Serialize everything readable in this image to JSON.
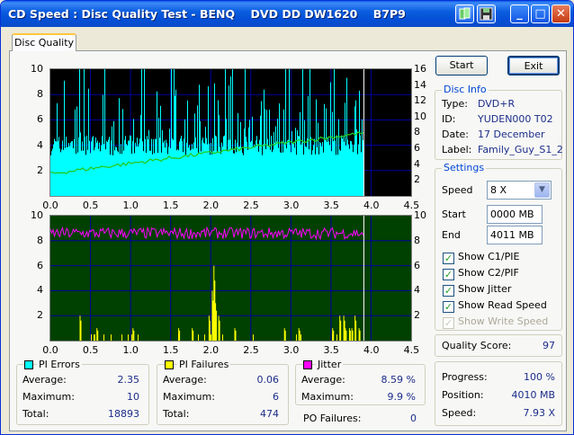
{
  "window": {
    "title": "CD Speed : Disc Quality Test - BENQ    DVD DD DW1620    B7P9",
    "tab": "Disc Quality"
  },
  "buttons": {
    "start": "Start",
    "exit": "Exit"
  },
  "disc_info": {
    "title": "Disc Info",
    "rows": [
      {
        "label": "Type:",
        "value": "DVD+R"
      },
      {
        "label": "ID:",
        "value": "YUDEN000 T02"
      },
      {
        "label": "Date:",
        "value": "17 December"
      },
      {
        "label": "Label:",
        "value": "Family_Guy_S1_2"
      }
    ]
  },
  "settings": {
    "title": "Settings",
    "speed_label": "Speed",
    "speed_value": "8 X",
    "start_label": "Start",
    "start_value": "0000 MB",
    "end_label": "End",
    "end_value": "4011 MB",
    "checks": [
      {
        "label": "Show C1/PIE",
        "checked": true,
        "disabled": false
      },
      {
        "label": "Show C2/PIF",
        "checked": true,
        "disabled": false
      },
      {
        "label": "Show Jitter",
        "checked": true,
        "disabled": false
      },
      {
        "label": "Show Read Speed",
        "checked": true,
        "disabled": false
      },
      {
        "label": "Show Write Speed",
        "checked": true,
        "disabled": true
      }
    ]
  },
  "quality": {
    "label": "Quality Score:",
    "value": "97"
  },
  "progress": {
    "rows": [
      {
        "label": "Progress:",
        "value": "100 %"
      },
      {
        "label": "Position:",
        "value": "4010 MB"
      },
      {
        "label": "Speed:",
        "value": "7.93 X"
      }
    ]
  },
  "stats": {
    "pi_errors": {
      "title": "PI Errors",
      "color": "#00ffff",
      "rows": [
        {
          "label": "Average:",
          "value": "2.35"
        },
        {
          "label": "Maximum:",
          "value": "10"
        },
        {
          "label": "Total:",
          "value": "18893"
        }
      ]
    },
    "pi_failures": {
      "title": "PI Failures",
      "color": "#ffff00",
      "rows": [
        {
          "label": "Average:",
          "value": "0.06"
        },
        {
          "label": "Maximum:",
          "value": "6"
        },
        {
          "label": "Total:",
          "value": "474"
        }
      ]
    },
    "jitter": {
      "title": "Jitter",
      "color": "#ff00ff",
      "rows": [
        {
          "label": "Average:",
          "value": "8.59 %"
        },
        {
          "label": "Maximum:",
          "value": "9.9 %"
        }
      ]
    },
    "po_failures": {
      "label": "PO Failures:",
      "value": "0"
    }
  },
  "graphs": {
    "top": {
      "y_left": [
        "10",
        "8",
        "6",
        "4",
        "2"
      ],
      "y_right": [
        "16",
        "14",
        "12",
        "10",
        "8",
        "6",
        "4",
        "2"
      ],
      "x": [
        "0.0",
        "0.5",
        "1.0",
        "1.5",
        "2.0",
        "2.5",
        "3.0",
        "3.5",
        "4.0",
        "4.5"
      ]
    },
    "bottom": {
      "y_left": [
        "10",
        "8",
        "6",
        "4",
        "2"
      ],
      "y_right": [
        "10",
        "8",
        "6",
        "4",
        "2"
      ],
      "x": [
        "0.0",
        "0.5",
        "1.0",
        "1.5",
        "2.0",
        "2.5",
        "3.0",
        "3.5",
        "4.0",
        "4.5"
      ]
    }
  },
  "colors": {
    "pie": "#00ffff",
    "pif": "#ffff00",
    "jitter": "#ff00ff",
    "speed": "#22cc22",
    "top_bg": "#000000",
    "bottom_bg": "#004000",
    "grid": "#0000a0"
  },
  "icons": [
    "app-icon",
    "save-icon",
    "minimize-icon",
    "maximize-icon",
    "close-icon"
  ]
}
